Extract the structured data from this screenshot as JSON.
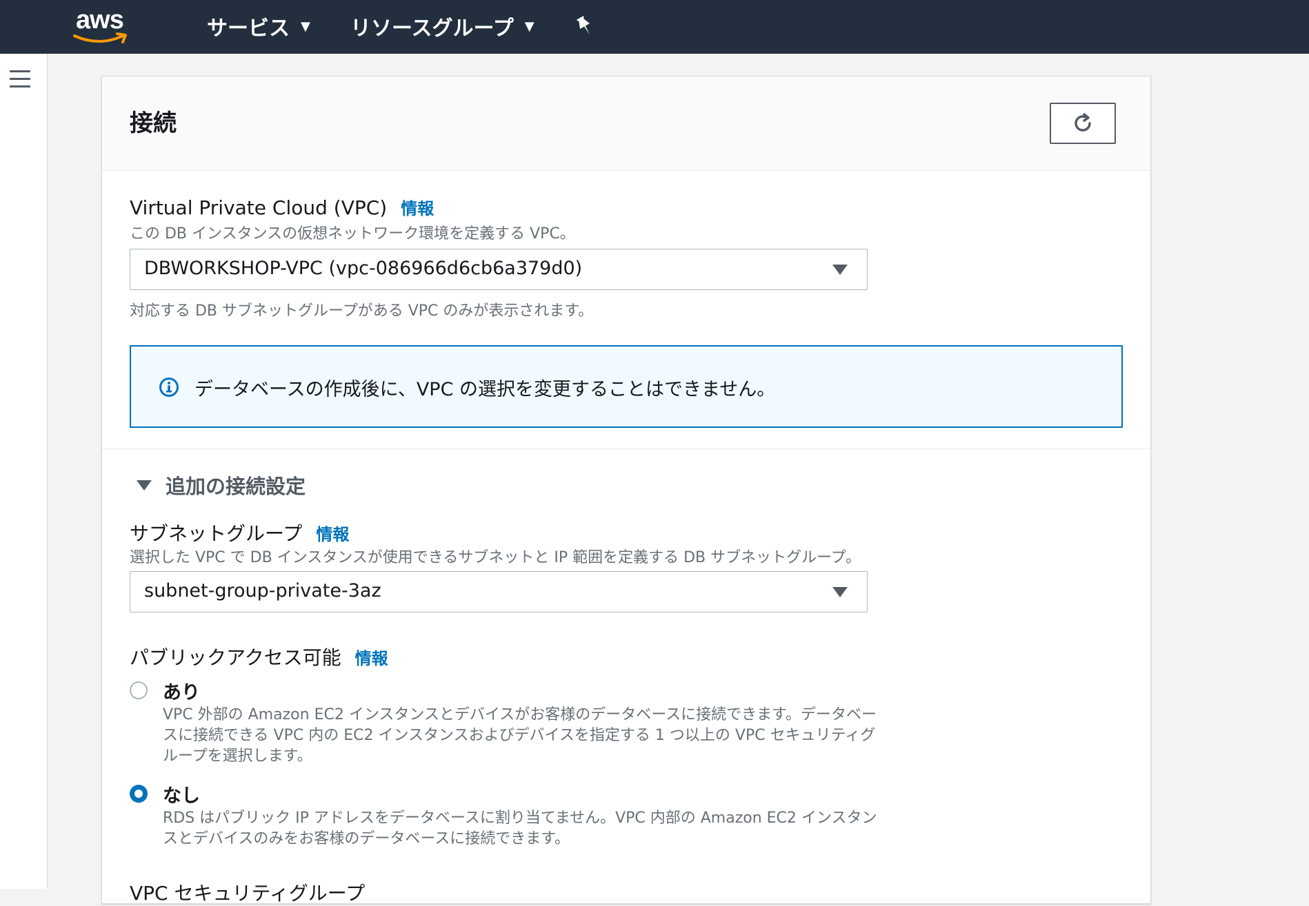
{
  "header": {
    "logo": "aws",
    "nav": [
      {
        "label": "サービス"
      },
      {
        "label": "リソースグループ"
      }
    ],
    "colors": {
      "bg": "#232f3e",
      "logo_smile": "#ff9900"
    }
  },
  "panel": {
    "title": "接続",
    "vpc": {
      "label": "Virtual Private Cloud (VPC)",
      "info": "情報",
      "description": "この DB インスタンスの仮想ネットワーク環境を定義する VPC。",
      "value": "DBWORKSHOP-VPC (vpc-086966d6cb6a379d0)",
      "hint": "対応する DB サブネットグループがある VPC のみが表示されます。"
    },
    "alert": {
      "text": "データベースの作成後に、VPC の選択を変更することはできません。"
    },
    "additional": {
      "title": "追加の接続設定",
      "subnet": {
        "label": "サブネットグループ",
        "info": "情報",
        "description": "選択した VPC で DB インスタンスが使用できるサブネットと IP 範囲を定義する DB サブネットグループ。",
        "value": "subnet-group-private-3az"
      },
      "public_access": {
        "label": "パブリックアクセス可能",
        "info": "情報",
        "options": [
          {
            "label": "あり",
            "description": "VPC 外部の Amazon EC2 インスタンスとデバイスがお客様のデータベースに接続できます。データベースに接続できる VPC 内の EC2 インスタンスおよびデバイスを指定する 1 つ以上の VPC セキュリティグループを選択します。",
            "selected": false
          },
          {
            "label": "なし",
            "description": "RDS はパブリック IP アドレスをデータベースに割り当てません。VPC 内部の Amazon EC2 インスタンスとデバイスのみをお客様のデータベースに接続できます。",
            "selected": true
          }
        ]
      },
      "security_group_label": "VPC セキュリティグループ"
    }
  }
}
